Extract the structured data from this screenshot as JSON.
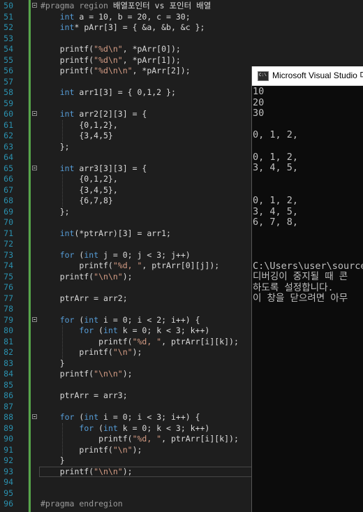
{
  "editor": {
    "lines": [
      {
        "n": "50",
        "fold": true,
        "segs": [
          {
            "c": "pp",
            "t": "#pragma region "
          },
          {
            "c": "",
            "t": "배열포인터 vs 포인터 배열"
          }
        ]
      },
      {
        "n": "51",
        "segs": [
          {
            "c": "",
            "t": "    "
          },
          {
            "c": "kw",
            "t": "int"
          },
          {
            "c": "",
            "t": " a = 10, b = 20, c = 30;"
          }
        ]
      },
      {
        "n": "52",
        "segs": [
          {
            "c": "",
            "t": "    "
          },
          {
            "c": "kw",
            "t": "int"
          },
          {
            "c": "",
            "t": "* pArr[3] = { &a, &b, &c };"
          }
        ]
      },
      {
        "n": "53",
        "segs": []
      },
      {
        "n": "54",
        "segs": [
          {
            "c": "",
            "t": "    printf("
          },
          {
            "c": "str",
            "t": "\"%d\\n\""
          },
          {
            "c": "",
            "t": ", *pArr[0]);"
          }
        ]
      },
      {
        "n": "55",
        "segs": [
          {
            "c": "",
            "t": "    printf("
          },
          {
            "c": "str",
            "t": "\"%d\\n\""
          },
          {
            "c": "",
            "t": ", *pArr[1]);"
          }
        ]
      },
      {
        "n": "56",
        "segs": [
          {
            "c": "",
            "t": "    printf("
          },
          {
            "c": "str",
            "t": "\"%d\\n\\n\""
          },
          {
            "c": "",
            "t": ", *pArr[2]);"
          }
        ]
      },
      {
        "n": "57",
        "segs": []
      },
      {
        "n": "58",
        "segs": [
          {
            "c": "",
            "t": "    "
          },
          {
            "c": "kw",
            "t": "int"
          },
          {
            "c": "",
            "t": " arr1[3] = { 0,1,2 };"
          }
        ]
      },
      {
        "n": "59",
        "segs": []
      },
      {
        "n": "60",
        "fold": true,
        "segs": [
          {
            "c": "",
            "t": "    "
          },
          {
            "c": "kw",
            "t": "int"
          },
          {
            "c": "",
            "t": " arr2[2][3] = {"
          }
        ]
      },
      {
        "n": "61",
        "segs": [
          {
            "c": "",
            "t": "        {0,1,2},"
          }
        ]
      },
      {
        "n": "62",
        "segs": [
          {
            "c": "",
            "t": "        {3,4,5}"
          }
        ]
      },
      {
        "n": "63",
        "segs": [
          {
            "c": "",
            "t": "    };"
          }
        ]
      },
      {
        "n": "64",
        "segs": []
      },
      {
        "n": "65",
        "fold": true,
        "segs": [
          {
            "c": "",
            "t": "    "
          },
          {
            "c": "kw",
            "t": "int"
          },
          {
            "c": "",
            "t": " arr3[3][3] = {"
          }
        ]
      },
      {
        "n": "66",
        "segs": [
          {
            "c": "",
            "t": "        {0,1,2},"
          }
        ]
      },
      {
        "n": "67",
        "segs": [
          {
            "c": "",
            "t": "        {3,4,5},"
          }
        ]
      },
      {
        "n": "68",
        "segs": [
          {
            "c": "",
            "t": "        {6,7,8}"
          }
        ]
      },
      {
        "n": "69",
        "segs": [
          {
            "c": "",
            "t": "    };"
          }
        ]
      },
      {
        "n": "70",
        "segs": []
      },
      {
        "n": "71",
        "segs": [
          {
            "c": "",
            "t": "    "
          },
          {
            "c": "kw",
            "t": "int"
          },
          {
            "c": "",
            "t": "(*ptrArr)[3] = arr1;"
          }
        ]
      },
      {
        "n": "72",
        "segs": []
      },
      {
        "n": "73",
        "segs": [
          {
            "c": "",
            "t": "    "
          },
          {
            "c": "kw",
            "t": "for"
          },
          {
            "c": "",
            "t": " ("
          },
          {
            "c": "kw",
            "t": "int"
          },
          {
            "c": "",
            "t": " j = 0; j < 3; j++)"
          }
        ]
      },
      {
        "n": "74",
        "segs": [
          {
            "c": "",
            "t": "        printf("
          },
          {
            "c": "str",
            "t": "\"%d, \""
          },
          {
            "c": "",
            "t": ", ptrArr[0][j]);"
          }
        ]
      },
      {
        "n": "75",
        "segs": [
          {
            "c": "",
            "t": "    printf("
          },
          {
            "c": "str",
            "t": "\"\\n\\n\""
          },
          {
            "c": "",
            "t": ");"
          }
        ]
      },
      {
        "n": "76",
        "segs": []
      },
      {
        "n": "77",
        "segs": [
          {
            "c": "",
            "t": "    ptrArr = arr2;"
          }
        ]
      },
      {
        "n": "78",
        "segs": []
      },
      {
        "n": "79",
        "fold": true,
        "segs": [
          {
            "c": "",
            "t": "    "
          },
          {
            "c": "kw",
            "t": "for"
          },
          {
            "c": "",
            "t": " ("
          },
          {
            "c": "kw",
            "t": "int"
          },
          {
            "c": "",
            "t": " i = 0; i < 2; i++) {"
          }
        ]
      },
      {
        "n": "80",
        "segs": [
          {
            "c": "",
            "t": "        "
          },
          {
            "c": "kw",
            "t": "for"
          },
          {
            "c": "",
            "t": " ("
          },
          {
            "c": "kw",
            "t": "int"
          },
          {
            "c": "",
            "t": " k = 0; k < 3; k++)"
          }
        ]
      },
      {
        "n": "81",
        "segs": [
          {
            "c": "",
            "t": "            printf("
          },
          {
            "c": "str",
            "t": "\"%d, \""
          },
          {
            "c": "",
            "t": ", ptrArr[i][k]);"
          }
        ]
      },
      {
        "n": "82",
        "segs": [
          {
            "c": "",
            "t": "        printf("
          },
          {
            "c": "str",
            "t": "\"\\n\""
          },
          {
            "c": "",
            "t": ");"
          }
        ]
      },
      {
        "n": "83",
        "segs": [
          {
            "c": "",
            "t": "    }"
          }
        ]
      },
      {
        "n": "84",
        "segs": [
          {
            "c": "",
            "t": "    printf("
          },
          {
            "c": "str",
            "t": "\"\\n\\n\""
          },
          {
            "c": "",
            "t": ");"
          }
        ]
      },
      {
        "n": "85",
        "segs": []
      },
      {
        "n": "86",
        "segs": [
          {
            "c": "",
            "t": "    ptrArr = arr3;"
          }
        ]
      },
      {
        "n": "87",
        "segs": []
      },
      {
        "n": "88",
        "fold": true,
        "segs": [
          {
            "c": "",
            "t": "    "
          },
          {
            "c": "kw",
            "t": "for"
          },
          {
            "c": "",
            "t": " ("
          },
          {
            "c": "kw",
            "t": "int"
          },
          {
            "c": "",
            "t": " i = 0; i < 3; i++) {"
          }
        ]
      },
      {
        "n": "89",
        "segs": [
          {
            "c": "",
            "t": "        "
          },
          {
            "c": "kw",
            "t": "for"
          },
          {
            "c": "",
            "t": " ("
          },
          {
            "c": "kw",
            "t": "int"
          },
          {
            "c": "",
            "t": " k = 0; k < 3; k++)"
          }
        ]
      },
      {
        "n": "90",
        "segs": [
          {
            "c": "",
            "t": "            printf("
          },
          {
            "c": "str",
            "t": "\"%d, \""
          },
          {
            "c": "",
            "t": ", ptrArr[i][k]);"
          }
        ]
      },
      {
        "n": "91",
        "segs": [
          {
            "c": "",
            "t": "        printf("
          },
          {
            "c": "str",
            "t": "\"\\n\""
          },
          {
            "c": "",
            "t": ");"
          }
        ]
      },
      {
        "n": "92",
        "segs": [
          {
            "c": "",
            "t": "    }"
          }
        ]
      },
      {
        "n": "93",
        "current": true,
        "segs": [
          {
            "c": "",
            "t": "    printf("
          },
          {
            "c": "str",
            "t": "\"\\n\\n\""
          },
          {
            "c": "",
            "t": ");"
          }
        ]
      },
      {
        "n": "94",
        "segs": []
      },
      {
        "n": "95",
        "segs": []
      },
      {
        "n": "96",
        "segs": [
          {
            "c": "pp",
            "t": "#pragma endregion"
          }
        ]
      }
    ]
  },
  "console": {
    "title": "Microsoft Visual Studio 디",
    "icon": "console-app-icon",
    "lines": [
      "10",
      "20",
      "30",
      "",
      "0, 1, 2,",
      "",
      "0, 1, 2,",
      "3, 4, 5,",
      "",
      "",
      "0, 1, 2,",
      "3, 4, 5,",
      "6, 7, 8,",
      "",
      "",
      "",
      "C:\\Users\\user\\source\\",
      "디버깅이 중지될 때 콘",
      "하도록 설정합니다.",
      "이 창을 닫으려면 아무"
    ]
  },
  "colors": {
    "editor_bg": "#1e1e1e",
    "keyword": "#569cd6",
    "string": "#d69d85",
    "line_number": "#2b91af",
    "change_bar": "#57a64a",
    "console_bg": "#0c0c0c",
    "console_text": "#c0c0c0"
  }
}
